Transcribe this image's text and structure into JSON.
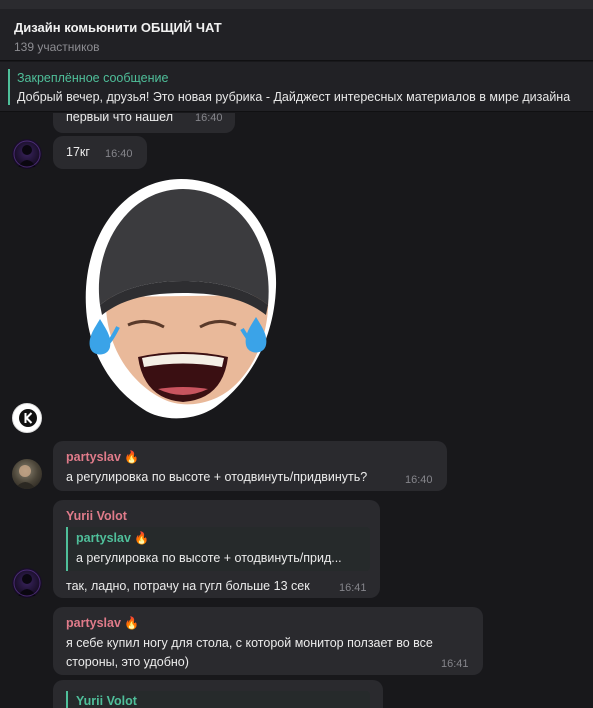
{
  "header": {
    "title": "Дизайн комьюнити ОБЩИЙ ЧАТ",
    "subtitle": "139 участников"
  },
  "pinned": {
    "label": "Закреплённое сообщение",
    "text": "Добрый вечер, друзья!  Это новая рубрика - Дайджест интересных материалов в мире дизайна"
  },
  "messages": [
    {
      "text": "первый что нашел",
      "time": "16:40"
    },
    {
      "text": "17кг",
      "time": "16:40"
    },
    {
      "sticker": "laughing-crying-face-sticker"
    },
    {
      "sender": "partyslav",
      "sender_emoji": "🔥",
      "sender_color": "#e07b8a",
      "text": "а регулировка по высоте + отодвинуть/придвинуть?",
      "time": "16:40"
    },
    {
      "sender": "Yurii Volot",
      "sender_color": "#e07b8a",
      "reply": {
        "sender": "partyslav",
        "sender_emoji": "🔥",
        "text": "а регулировка по высоте + отодвинуть/прид..."
      },
      "text": "так, ладно, потрачу на гугл больше 13 сек",
      "time": "16:41"
    },
    {
      "sender": "partyslav",
      "sender_emoji": "🔥",
      "sender_color": "#e07b8a",
      "lines": [
        "я себе купил ногу для стола, с которой монитор ползает во все",
        "стороны, это удобно)"
      ],
      "time": "16:41"
    },
    {
      "reply": {
        "sender": "Yurii Volot"
      }
    }
  ],
  "colors": {
    "accent": "#4fbf9a",
    "sender": "#e07b8a",
    "background": "#18181b",
    "bubble": "#2a2a2e"
  }
}
